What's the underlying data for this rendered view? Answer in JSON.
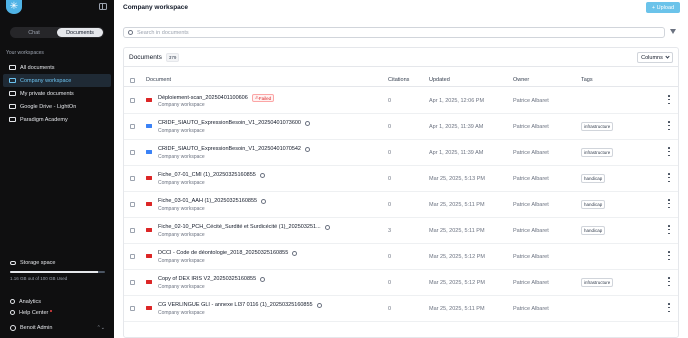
{
  "sidebar": {
    "logo_glyph": "✳",
    "tabs": [
      {
        "label": "Chat",
        "active": false
      },
      {
        "label": "Documents",
        "active": true
      }
    ],
    "workspaces_label": "Your workspaces",
    "items": [
      {
        "label": "All documents",
        "active": false
      },
      {
        "label": "Company workspace",
        "active": true
      },
      {
        "label": "My private documents",
        "active": false
      },
      {
        "label": "Google Drive - LightOn",
        "active": false
      },
      {
        "label": "Paradigm Academy",
        "active": false
      }
    ],
    "storage": {
      "label": "Storage space",
      "text": "1.16 GB out of 100 GB Used",
      "used_fraction": 0.93
    },
    "links": [
      {
        "label": "Analytics"
      },
      {
        "label": "Help Center"
      }
    ],
    "user": {
      "name": "Benoit Admin"
    }
  },
  "main": {
    "title": "Company workspace",
    "upload_label": "+ Upload",
    "search_placeholder": "Search in documents",
    "panel_title": "Documents",
    "count": "379",
    "columns_label": "Columns",
    "headers": {
      "document": "Document",
      "citations": "Citations",
      "updated": "Updated",
      "owner": "Owner",
      "tags": "Tags"
    },
    "rows": [
      {
        "name": "Déploiement-scan_20250401100606",
        "type": "pdf",
        "sub": "Company workspace",
        "status": "Failed",
        "citations": "0",
        "updated": "Apr 1, 2025, 12:06 PM",
        "owner": "Patrice Albaret",
        "tag": ""
      },
      {
        "name": "CRIDF_SIAUTO_ExpressionBesoin_V1_20250401073600",
        "type": "doc",
        "sub": "Company workspace",
        "status": "",
        "citations": "0",
        "updated": "Apr 1, 2025, 11:39 AM",
        "owner": "Patrice Albaret",
        "tag": "infrastructure"
      },
      {
        "name": "CRIDF_SIAUTO_ExpressionBesoin_V1_20250401070542",
        "type": "doc",
        "sub": "Company workspace",
        "status": "",
        "citations": "0",
        "updated": "Apr 1, 2025, 11:39 AM",
        "owner": "Patrice Albaret",
        "tag": "infrastructure"
      },
      {
        "name": "Fiche_07-01_CMI (1)_20250325160855",
        "type": "pdf",
        "sub": "Company workspace",
        "status": "",
        "citations": "0",
        "updated": "Mar 25, 2025, 5:13 PM",
        "owner": "Patrice Albaret",
        "tag": "handicap"
      },
      {
        "name": "Fiche_03-01_AAH (1)_20250325160855",
        "type": "pdf",
        "sub": "Company workspace",
        "status": "",
        "citations": "0",
        "updated": "Mar 25, 2025, 5:11 PM",
        "owner": "Patrice Albaret",
        "tag": "handicap"
      },
      {
        "name": "Fiche_02-10_PCH_Cécité_Surdité et Surdicécité (1)_202503251...",
        "type": "pdf",
        "sub": "Company workspace",
        "status": "",
        "citations": "3",
        "updated": "Mar 25, 2025, 5:11 PM",
        "owner": "Patrice Albaret",
        "tag": "handicap"
      },
      {
        "name": "DCCI - Code de déontologie_2018_20250325160855",
        "type": "pdf",
        "sub": "Company workspace",
        "status": "",
        "citations": "0",
        "updated": "Mar 25, 2025, 5:12 PM",
        "owner": "Patrice Albaret",
        "tag": ""
      },
      {
        "name": "Copy of DEX IRIS V2_20250325160855",
        "type": "pdf",
        "sub": "Company workspace",
        "status": "",
        "citations": "0",
        "updated": "Mar 25, 2025, 5:12 PM",
        "owner": "Patrice Albaret",
        "tag": "infrastructure"
      },
      {
        "name": "CG VERLINGUE GLI - annexe LI37 0116 (1)_20250325160855",
        "type": "pdf",
        "sub": "Company workspace",
        "status": "",
        "citations": "0",
        "updated": "Mar 25, 2025, 5:11 PM",
        "owner": "Patrice Albaret",
        "tag": ""
      }
    ]
  }
}
